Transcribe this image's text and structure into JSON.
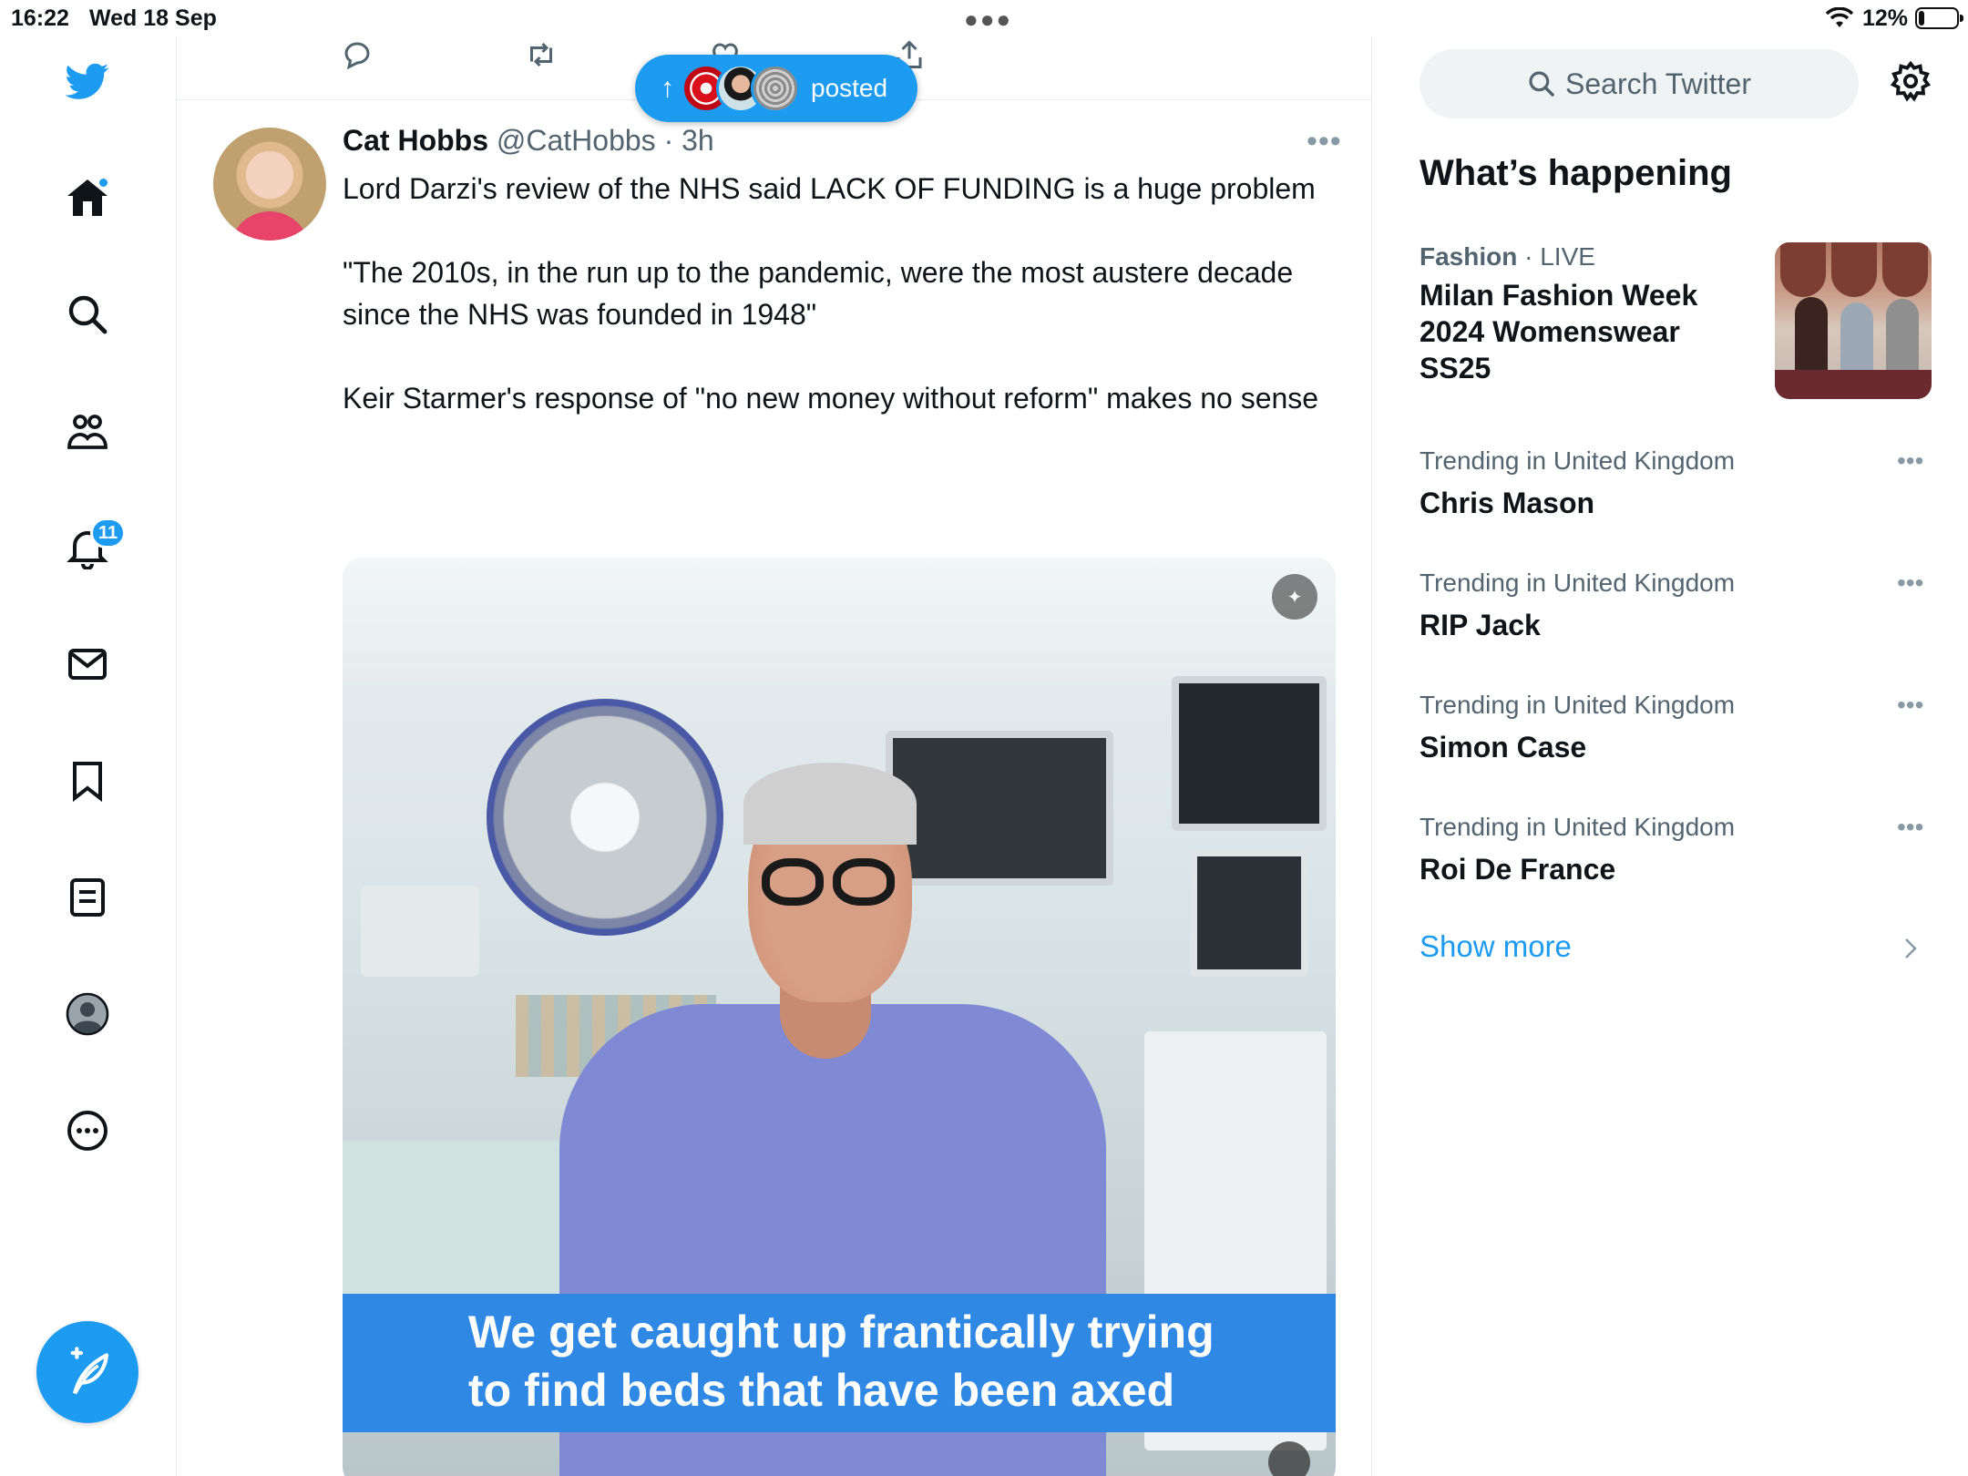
{
  "status": {
    "time": "16:22",
    "date": "Wed 18 Sep",
    "battery": "12%"
  },
  "nav": {
    "notifications_badge": "11",
    "icons": [
      "twitter-bird-icon",
      "home-icon",
      "search-icon",
      "communities-icon",
      "notifications-icon",
      "messages-icon",
      "bookmarks-icon",
      "lists-icon",
      "profile-icon",
      "more-icon",
      "compose-icon"
    ]
  },
  "pill": {
    "label": "posted"
  },
  "tweet": {
    "name": "Cat Hobbs",
    "handle": "@CatHobbs",
    "time": "3h",
    "text": "Lord Darzi's review of the NHS said LACK OF FUNDING is a huge problem\n\n\"The 2010s, in the run up to the pandemic, were the most austere decade since the NHS was founded in 1948\"\n\nKeir Starmer's response of \"no new money without reform\" makes no sense",
    "media_caption_line1": "We get caught up frantically trying",
    "media_caption_line2": "to find beds that have been axed"
  },
  "sidebar": {
    "search_placeholder": "Search Twitter",
    "section_title": "What’s happening",
    "featured": {
      "category": "Fashion",
      "status": "LIVE",
      "title": "Milan Fashion Week 2024 Womenswear SS25"
    },
    "trends": [
      {
        "category": "Trending in United Kingdom",
        "title": "Chris Mason"
      },
      {
        "category": "Trending in United Kingdom",
        "title": "RIP Jack"
      },
      {
        "category": "Trending in United Kingdom",
        "title": "Simon Case"
      },
      {
        "category": "Trending in United Kingdom",
        "title": "Roi De France"
      }
    ],
    "show_more": "Show more"
  },
  "colors": {
    "accent": "#1d9bf0",
    "text": "#0f1419",
    "muted": "#536471",
    "caption_bg": "#2f88e4"
  }
}
